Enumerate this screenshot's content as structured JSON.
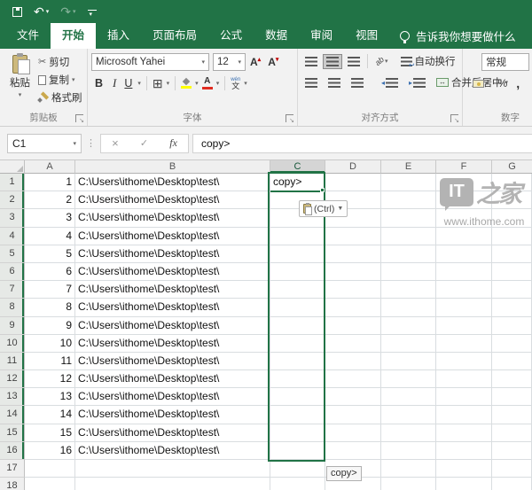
{
  "qat": {
    "save": "save",
    "undo": "undo",
    "redo": "redo",
    "customize": "customize-quick-access-toolbar"
  },
  "tabs": [
    {
      "label": "文件",
      "active": false
    },
    {
      "label": "开始",
      "active": true
    },
    {
      "label": "插入",
      "active": false
    },
    {
      "label": "页面布局",
      "active": false
    },
    {
      "label": "公式",
      "active": false
    },
    {
      "label": "数据",
      "active": false
    },
    {
      "label": "审阅",
      "active": false
    },
    {
      "label": "视图",
      "active": false
    }
  ],
  "tell_me": "告诉我你想要做什么",
  "ribbon": {
    "clipboard": {
      "paste": "粘贴",
      "cut": "剪切",
      "copy": "复制",
      "format_painter": "格式刷",
      "label": "剪贴板"
    },
    "font": {
      "family": "Microsoft Yahei",
      "size": "12",
      "bold": "B",
      "italic": "I",
      "underline": "U",
      "phonetic_top": "wén",
      "phonetic_char": "文",
      "label": "字体"
    },
    "alignment": {
      "orientation": "ab",
      "wrap": "自动换行",
      "merge": "合并后居中",
      "label": "对齐方式"
    },
    "number": {
      "format": "常规",
      "percent": "%",
      "comma": ",",
      "label": "数字"
    }
  },
  "formula_bar": {
    "name_box": "C1",
    "cancel": "×",
    "enter": "✓",
    "fx": "fx",
    "content": "copy>"
  },
  "grid": {
    "columns": [
      "A",
      "B",
      "C",
      "D",
      "E",
      "F",
      "G"
    ],
    "selected_column": "C",
    "selected_rows_from": 1,
    "selected_rows_to": 16,
    "rows": [
      {
        "n": "1",
        "a": "1",
        "b": "C:\\Users\\ithome\\Desktop\\test\\",
        "c": "copy>"
      },
      {
        "n": "2",
        "a": "2",
        "b": "C:\\Users\\ithome\\Desktop\\test\\",
        "c": ""
      },
      {
        "n": "3",
        "a": "3",
        "b": "C:\\Users\\ithome\\Desktop\\test\\",
        "c": ""
      },
      {
        "n": "4",
        "a": "4",
        "b": "C:\\Users\\ithome\\Desktop\\test\\",
        "c": ""
      },
      {
        "n": "5",
        "a": "5",
        "b": "C:\\Users\\ithome\\Desktop\\test\\",
        "c": ""
      },
      {
        "n": "6",
        "a": "6",
        "b": "C:\\Users\\ithome\\Desktop\\test\\",
        "c": ""
      },
      {
        "n": "7",
        "a": "7",
        "b": "C:\\Users\\ithome\\Desktop\\test\\",
        "c": ""
      },
      {
        "n": "8",
        "a": "8",
        "b": "C:\\Users\\ithome\\Desktop\\test\\",
        "c": ""
      },
      {
        "n": "9",
        "a": "9",
        "b": "C:\\Users\\ithome\\Desktop\\test\\",
        "c": ""
      },
      {
        "n": "10",
        "a": "10",
        "b": "C:\\Users\\ithome\\Desktop\\test\\",
        "c": ""
      },
      {
        "n": "11",
        "a": "11",
        "b": "C:\\Users\\ithome\\Desktop\\test\\",
        "c": ""
      },
      {
        "n": "12",
        "a": "12",
        "b": "C:\\Users\\ithome\\Desktop\\test\\",
        "c": ""
      },
      {
        "n": "13",
        "a": "13",
        "b": "C:\\Users\\ithome\\Desktop\\test\\",
        "c": ""
      },
      {
        "n": "14",
        "a": "14",
        "b": "C:\\Users\\ithome\\Desktop\\test\\",
        "c": ""
      },
      {
        "n": "15",
        "a": "15",
        "b": "C:\\Users\\ithome\\Desktop\\test\\",
        "c": ""
      },
      {
        "n": "16",
        "a": "16",
        "b": "C:\\Users\\ithome\\Desktop\\test\\",
        "c": ""
      },
      {
        "n": "17",
        "a": "",
        "b": "",
        "c": ""
      },
      {
        "n": "18",
        "a": "",
        "b": "",
        "c": ""
      }
    ]
  },
  "paste_options": {
    "label": "(Ctrl)"
  },
  "fill_tooltip": "copy>",
  "watermark": {
    "logo_text": "IT",
    "logo_suffix": "之家",
    "url": "www.ithome.com"
  },
  "colors": {
    "excel_green": "#217346",
    "selection_border": "#217346",
    "fill_yellow": "#ffff00",
    "font_red": "#e02b20",
    "watermark_gray": "#b3b3b3"
  }
}
